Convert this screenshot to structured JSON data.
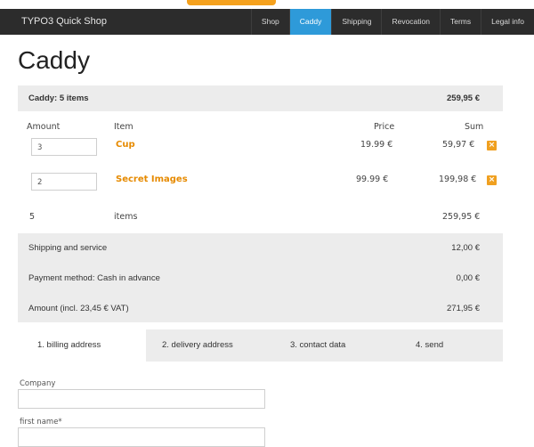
{
  "brand": "TYPO3 Quick Shop",
  "nav": [
    "Shop",
    "Caddy",
    "Shipping",
    "Revocation",
    "Terms",
    "Legal info"
  ],
  "nav_active_color": "#2e9ad9",
  "page_title": "Caddy",
  "summary": {
    "label": "Caddy: 5 items",
    "total": "259,95 €"
  },
  "columns": {
    "amount": "Amount",
    "item": "Item",
    "price": "Price",
    "sum": "Sum"
  },
  "rows": [
    {
      "qty": "3",
      "name": "Cup",
      "price": "19.99 €",
      "sum": "59,97 €"
    },
    {
      "qty": "2",
      "name": "Secret Images",
      "price": "99.99 €",
      "sum": "199,98 €"
    }
  ],
  "footer_row": {
    "count": "5",
    "label": "items",
    "total": "259,95 €"
  },
  "shipping": {
    "label": "Shipping and service",
    "value": "12,00 €"
  },
  "payment": {
    "label": "Payment method: Cash in advance",
    "value": "0,00 €"
  },
  "amount": {
    "label": "Amount (incl. 23,45 € VAT)",
    "value": "271,95 €"
  },
  "tabs": [
    "1. billing address",
    "2. delivery address",
    "3. contact data",
    "4. send"
  ],
  "form": {
    "company_label": "Company",
    "firstname_label": "first name*"
  },
  "accent_color": "#e68a00"
}
